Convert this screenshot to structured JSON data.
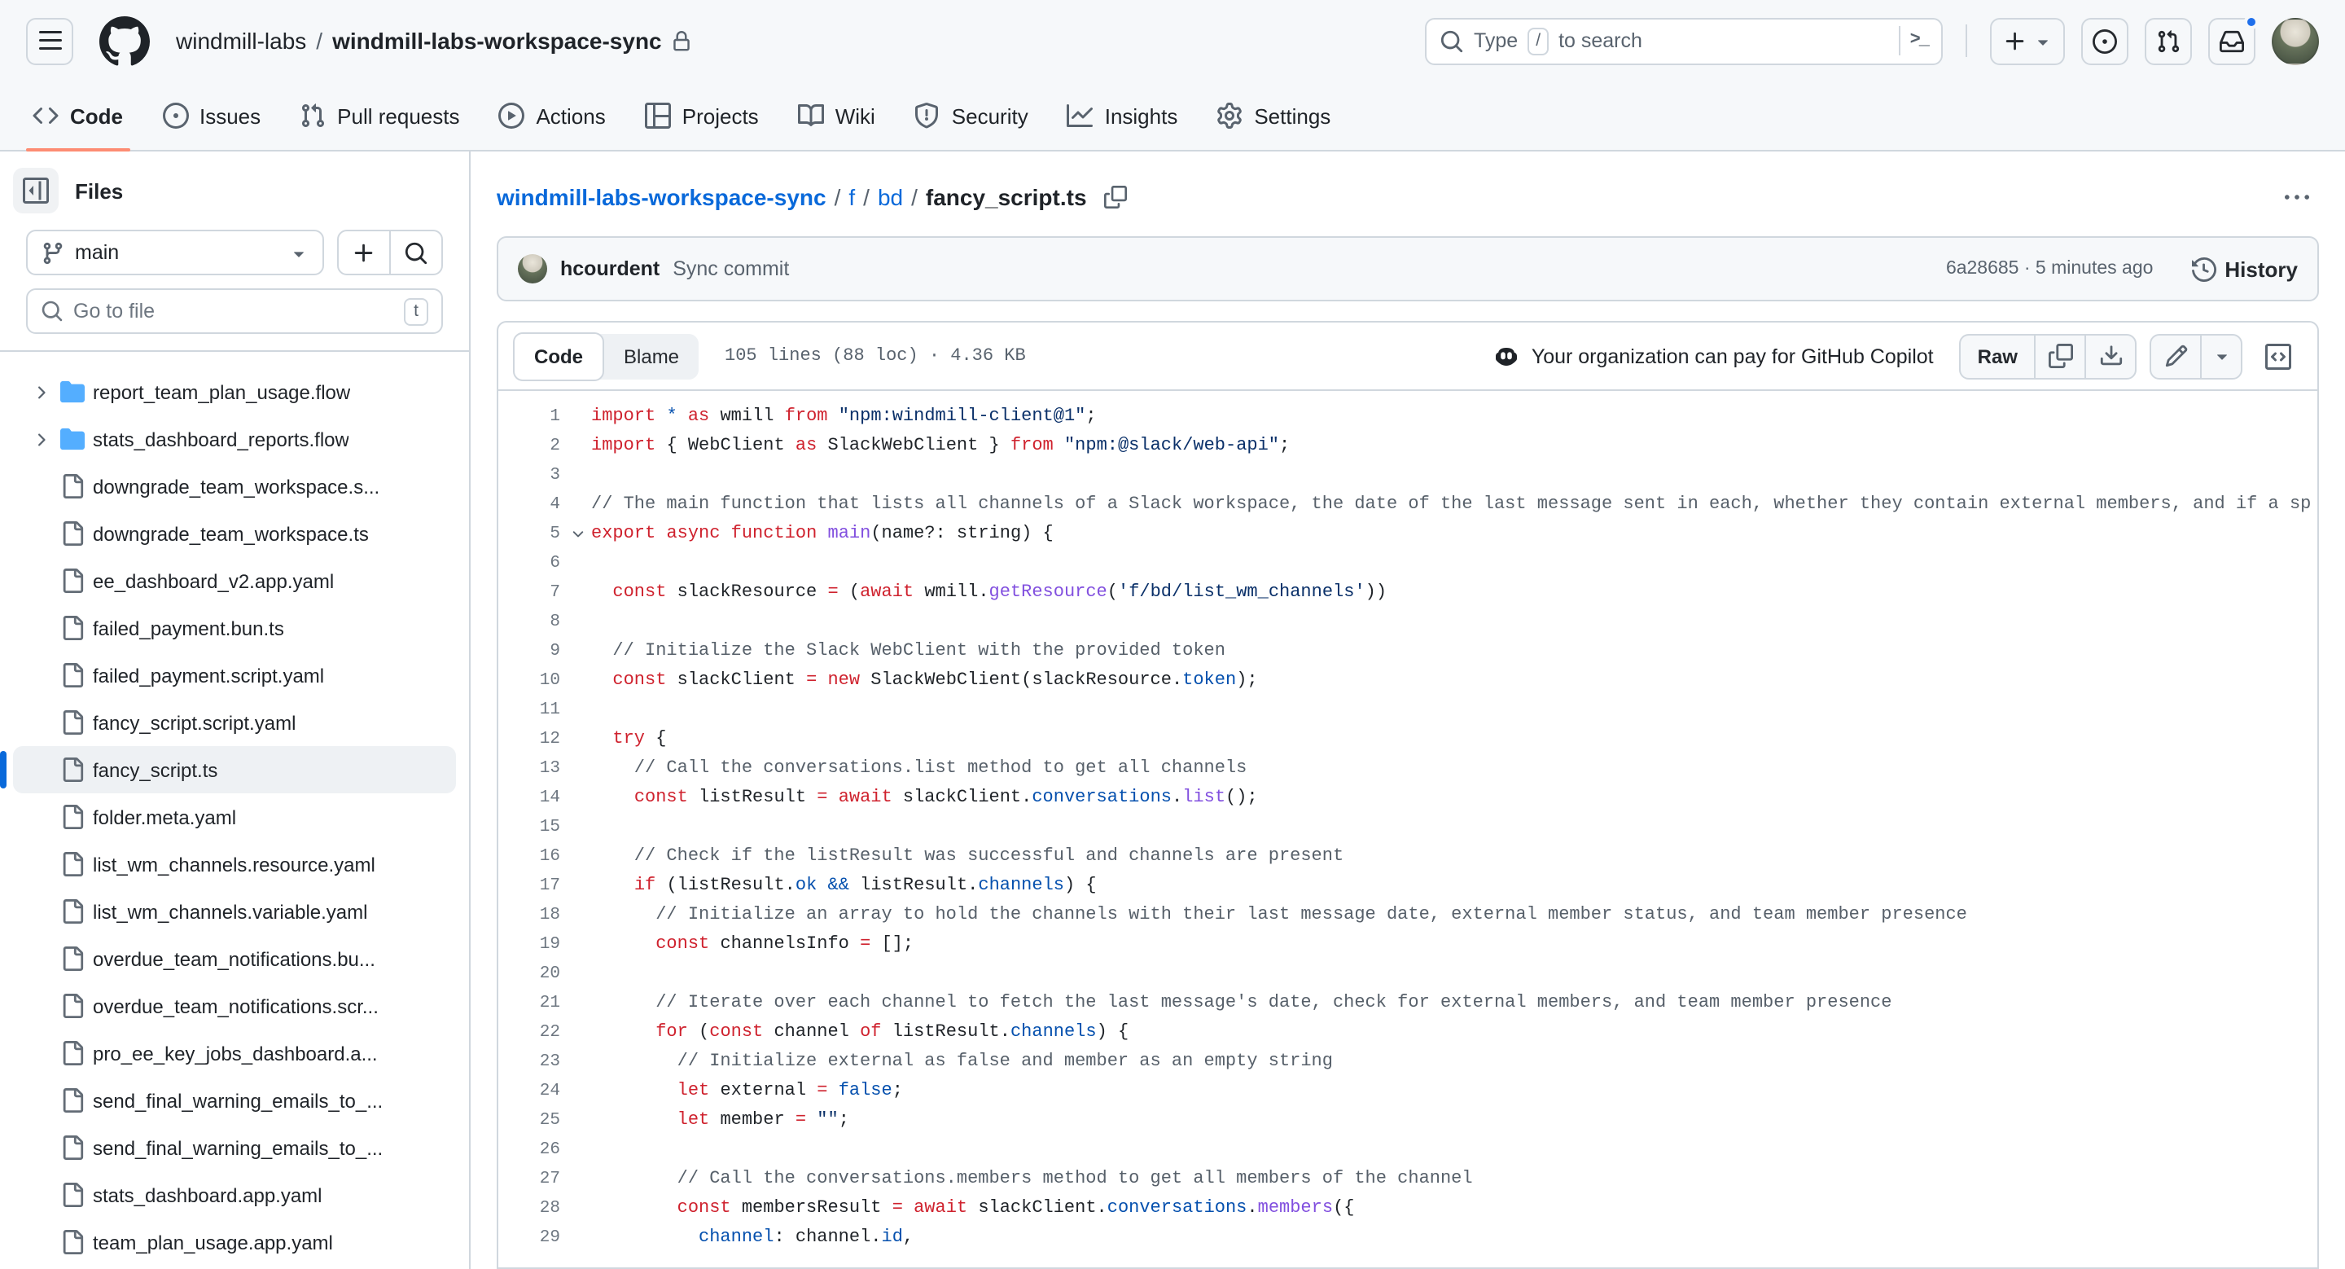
{
  "colors": {
    "border": "#d0d7de",
    "muted": "#59636e",
    "fg": "#1f2328",
    "link": "#0969da",
    "accent": "#fd8c73",
    "bg": "#f6f8fa",
    "folder": "#54aeff",
    "dot": "#1f6feb"
  },
  "header": {
    "org": "windmill-labs",
    "repo": "windmill-labs-workspace-sync",
    "search": {
      "before": "Type",
      "key": "/",
      "after": "to search",
      "terminal": ">_"
    },
    "action_icons": [
      "plus-icon",
      "issue-opened-icon",
      "git-pull-request-icon",
      "inbox-icon",
      "avatar"
    ]
  },
  "repo_nav": {
    "tabs": [
      {
        "label": "Code",
        "icon": "code",
        "active": true
      },
      {
        "label": "Issues",
        "icon": "issue-opened",
        "active": false
      },
      {
        "label": "Pull requests",
        "icon": "git-pull-request",
        "active": false
      },
      {
        "label": "Actions",
        "icon": "play",
        "active": false
      },
      {
        "label": "Projects",
        "icon": "table",
        "active": false
      },
      {
        "label": "Wiki",
        "icon": "book",
        "active": false
      },
      {
        "label": "Security",
        "icon": "shield",
        "active": false
      },
      {
        "label": "Insights",
        "icon": "graph",
        "active": false
      },
      {
        "label": "Settings",
        "icon": "gear",
        "active": false
      }
    ]
  },
  "sidebar": {
    "files_title": "Files",
    "branch": "main",
    "goto_placeholder": "Go to file",
    "goto_key": "t",
    "tree": [
      {
        "type": "folder",
        "label": "report_team_plan_usage.flow",
        "selected": false
      },
      {
        "type": "folder",
        "label": "stats_dashboard_reports.flow",
        "selected": false
      },
      {
        "type": "file",
        "label": "downgrade_team_workspace.s...",
        "selected": false
      },
      {
        "type": "file",
        "label": "downgrade_team_workspace.ts",
        "selected": false
      },
      {
        "type": "file",
        "label": "ee_dashboard_v2.app.yaml",
        "selected": false
      },
      {
        "type": "file",
        "label": "failed_payment.bun.ts",
        "selected": false
      },
      {
        "type": "file",
        "label": "failed_payment.script.yaml",
        "selected": false
      },
      {
        "type": "file",
        "label": "fancy_script.script.yaml",
        "selected": false
      },
      {
        "type": "file",
        "label": "fancy_script.ts",
        "selected": true
      },
      {
        "type": "file",
        "label": "folder.meta.yaml",
        "selected": false
      },
      {
        "type": "file",
        "label": "list_wm_channels.resource.yaml",
        "selected": false
      },
      {
        "type": "file",
        "label": "list_wm_channels.variable.yaml",
        "selected": false
      },
      {
        "type": "file",
        "label": "overdue_team_notifications.bu...",
        "selected": false
      },
      {
        "type": "file",
        "label": "overdue_team_notifications.scr...",
        "selected": false
      },
      {
        "type": "file",
        "label": "pro_ee_key_jobs_dashboard.a...",
        "selected": false
      },
      {
        "type": "file",
        "label": "send_final_warning_emails_to_...",
        "selected": false
      },
      {
        "type": "file",
        "label": "send_final_warning_emails_to_...",
        "selected": false
      },
      {
        "type": "file",
        "label": "stats_dashboard.app.yaml",
        "selected": false
      },
      {
        "type": "file",
        "label": "team_plan_usage.app.yaml",
        "selected": false
      }
    ]
  },
  "main": {
    "breadcrumb": {
      "repo": "windmill-labs-workspace-sync",
      "sep": "/",
      "p1": "f",
      "p2": "bd",
      "file": "fancy_script.ts"
    },
    "commit": {
      "author": "hcourdent",
      "message": "Sync commit",
      "meta": "6a28685 · 5 minutes ago",
      "history": "History"
    },
    "toolbar": {
      "code_tab": "Code",
      "blame_tab": "Blame",
      "meta": "105 lines (88 loc) · 4.36 KB",
      "copilot": "Your organization can pay for GitHub Copilot",
      "raw": "Raw"
    }
  },
  "code": {
    "lines": [
      {
        "n": 1,
        "t": [
          [
            "k",
            "import "
          ],
          [
            "c",
            "*"
          ],
          [
            "k",
            " as "
          ],
          [
            "p",
            "wmill "
          ],
          [
            "k",
            "from "
          ],
          [
            "s",
            "\"npm:windmill-client@1\""
          ],
          [
            "p",
            ";"
          ]
        ]
      },
      {
        "n": 2,
        "t": [
          [
            "k",
            "import "
          ],
          [
            "p",
            "{ WebClient "
          ],
          [
            "k",
            "as "
          ],
          [
            "p",
            "SlackWebClient } "
          ],
          [
            "k",
            "from "
          ],
          [
            "s",
            "\"npm:@slack/web-api\""
          ],
          [
            "p",
            ";"
          ]
        ]
      },
      {
        "n": 3,
        "t": []
      },
      {
        "n": 4,
        "t": [
          [
            "cm",
            "// The main function that lists all channels of a Slack workspace, the date of the last message sent in each, whether they contain external members, and if a sp"
          ]
        ]
      },
      {
        "n": 5,
        "fold": true,
        "t": [
          [
            "k",
            "export "
          ],
          [
            "k",
            "async "
          ],
          [
            "k",
            "function "
          ],
          [
            "f",
            "main"
          ],
          [
            "p",
            "(name?: string) {"
          ]
        ]
      },
      {
        "n": 6,
        "t": []
      },
      {
        "n": 7,
        "t": [
          [
            "p",
            "  "
          ],
          [
            "k",
            "const "
          ],
          [
            "p",
            "slackResource "
          ],
          [
            "k",
            "= "
          ],
          [
            "p",
            "("
          ],
          [
            "k",
            "await "
          ],
          [
            "p",
            "wmill."
          ],
          [
            "f",
            "getResource"
          ],
          [
            "p",
            "("
          ],
          [
            "s",
            "'f/bd/list_wm_channels'"
          ],
          [
            "p",
            "))"
          ]
        ]
      },
      {
        "n": 8,
        "t": []
      },
      {
        "n": 9,
        "t": [
          [
            "cm",
            "  // Initialize the Slack WebClient with the provided token"
          ]
        ]
      },
      {
        "n": 10,
        "t": [
          [
            "p",
            "  "
          ],
          [
            "k",
            "const "
          ],
          [
            "p",
            "slackClient "
          ],
          [
            "k",
            "= "
          ],
          [
            "k",
            "new "
          ],
          [
            "p",
            "SlackWebClient(slackResource."
          ],
          [
            "c",
            "token"
          ],
          [
            "p",
            ");"
          ]
        ]
      },
      {
        "n": 11,
        "t": []
      },
      {
        "n": 12,
        "t": [
          [
            "p",
            "  "
          ],
          [
            "k",
            "try "
          ],
          [
            "p",
            "{"
          ]
        ]
      },
      {
        "n": 13,
        "t": [
          [
            "cm",
            "    // Call the conversations.list method to get all channels"
          ]
        ]
      },
      {
        "n": 14,
        "t": [
          [
            "p",
            "    "
          ],
          [
            "k",
            "const "
          ],
          [
            "p",
            "listResult "
          ],
          [
            "k",
            "= "
          ],
          [
            "k",
            "await "
          ],
          [
            "p",
            "slackClient."
          ],
          [
            "c",
            "conversations"
          ],
          [
            "p",
            "."
          ],
          [
            "f",
            "list"
          ],
          [
            "p",
            "();"
          ]
        ]
      },
      {
        "n": 15,
        "t": []
      },
      {
        "n": 16,
        "t": [
          [
            "cm",
            "    // Check if the listResult was successful and channels are present"
          ]
        ]
      },
      {
        "n": 17,
        "t": [
          [
            "p",
            "    "
          ],
          [
            "k",
            "if "
          ],
          [
            "p",
            "(listResult."
          ],
          [
            "c",
            "ok "
          ],
          [
            "c",
            "&& "
          ],
          [
            "p",
            "listResult."
          ],
          [
            "c",
            "channels"
          ],
          [
            "p",
            ") {"
          ]
        ]
      },
      {
        "n": 18,
        "t": [
          [
            "cm",
            "      // Initialize an array to hold the channels with their last message date, external member status, and team member presence"
          ]
        ]
      },
      {
        "n": 19,
        "t": [
          [
            "p",
            "      "
          ],
          [
            "k",
            "const "
          ],
          [
            "p",
            "channelsInfo "
          ],
          [
            "k",
            "= "
          ],
          [
            "p",
            "[];"
          ]
        ]
      },
      {
        "n": 20,
        "t": []
      },
      {
        "n": 21,
        "t": [
          [
            "cm",
            "      // Iterate over each channel to fetch the last message's date, check for external members, and team member presence"
          ]
        ]
      },
      {
        "n": 22,
        "t": [
          [
            "p",
            "      "
          ],
          [
            "k",
            "for "
          ],
          [
            "p",
            "("
          ],
          [
            "k",
            "const "
          ],
          [
            "p",
            "channel "
          ],
          [
            "k",
            "of "
          ],
          [
            "p",
            "listResult."
          ],
          [
            "c",
            "channels"
          ],
          [
            "p",
            ") {"
          ]
        ]
      },
      {
        "n": 23,
        "t": [
          [
            "cm",
            "        // Initialize external as false and member as an empty string"
          ]
        ]
      },
      {
        "n": 24,
        "t": [
          [
            "p",
            "        "
          ],
          [
            "k",
            "let "
          ],
          [
            "p",
            "external "
          ],
          [
            "k",
            "= "
          ],
          [
            "c",
            "false"
          ],
          [
            "p",
            ";"
          ]
        ]
      },
      {
        "n": 25,
        "t": [
          [
            "p",
            "        "
          ],
          [
            "k",
            "let "
          ],
          [
            "p",
            "member "
          ],
          [
            "k",
            "= "
          ],
          [
            "s",
            "\"\""
          ],
          [
            "p",
            ";"
          ]
        ]
      },
      {
        "n": 26,
        "t": []
      },
      {
        "n": 27,
        "t": [
          [
            "cm",
            "        // Call the conversations.members method to get all members of the channel"
          ]
        ]
      },
      {
        "n": 28,
        "t": [
          [
            "p",
            "        "
          ],
          [
            "k",
            "const "
          ],
          [
            "p",
            "membersResult "
          ],
          [
            "k",
            "= "
          ],
          [
            "k",
            "await "
          ],
          [
            "p",
            "slackClient."
          ],
          [
            "c",
            "conversations"
          ],
          [
            "p",
            "."
          ],
          [
            "f",
            "members"
          ],
          [
            "p",
            "({"
          ]
        ]
      },
      {
        "n": 29,
        "t": [
          [
            "p",
            "          "
          ],
          [
            "c",
            "channel"
          ],
          [
            "p",
            ": channel."
          ],
          [
            "c",
            "id"
          ],
          [
            "p",
            ","
          ]
        ]
      }
    ]
  }
}
